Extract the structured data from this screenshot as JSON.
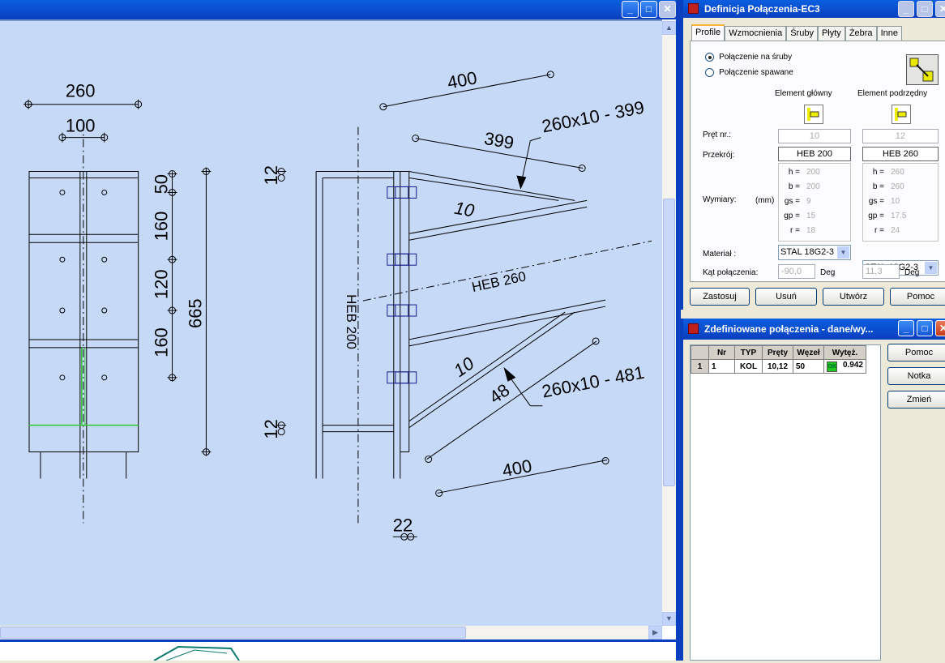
{
  "drawing": {
    "dims": {
      "d260": "260",
      "d100": "100",
      "d50": "50",
      "d160a": "160",
      "d120": "120",
      "d160b": "160",
      "d665": "665",
      "d12a": "12",
      "d12b": "12",
      "d22": "22",
      "d400top": "400",
      "d399": "399",
      "d10a": "10",
      "d10b": "10",
      "d48": "48",
      "d400bot": "400",
      "plate1": "260x10 - 399",
      "plate2": "260x10 - 481",
      "heb260": "HEB 260",
      "heb200": "HEB 200"
    }
  },
  "dialog1": {
    "title": "Definicja Połączenia-EC3",
    "tabs": [
      "Profile",
      "Wzmocnienia",
      "Śruby",
      "Płyty",
      "Żebra",
      "Inne"
    ],
    "radio1": "Połączenie na śruby",
    "radio2": "Połączenie spawane",
    "col1": "Element główny",
    "col2": "Element podrzędny",
    "pret_label": "Pręt nr.:",
    "pret1": "10",
    "pret2": "12",
    "przekroj_label": "Przekrój:",
    "przekroj1": "HEB 200",
    "przekroj2": "HEB 260",
    "wymiary_label": "Wymiary:",
    "unit": "(mm)",
    "dims1": [
      [
        "h =",
        "200"
      ],
      [
        "b =",
        "200"
      ],
      [
        "gs =",
        "9"
      ],
      [
        "gp =",
        "15"
      ],
      [
        "r =",
        "18"
      ]
    ],
    "dims2": [
      [
        "h =",
        "260"
      ],
      [
        "b =",
        "260"
      ],
      [
        "gs =",
        "10"
      ],
      [
        "gp =",
        "17.5"
      ],
      [
        "r =",
        "24"
      ]
    ],
    "material_label": "Materiał :",
    "material1": "STAL 18G2-3",
    "material2": "STAL 18G2-3",
    "kat_label": "Kąt połączenia:",
    "kat1": "-90,0",
    "kat2": "11,3",
    "deg": "Deg",
    "buttons": [
      "Zastosuj",
      "Usuń",
      "Utwórz",
      "Pomoc"
    ]
  },
  "dialog2": {
    "title": "Zdefiniowane połączenia - dane/wy...",
    "headers": [
      "Nr",
      "TYP",
      "Pręty",
      "Węzeł",
      "Wytęż."
    ],
    "row": {
      "idx": "1",
      "nr": "1",
      "typ": "KOL",
      "prety": "10,12",
      "wezel": "50",
      "status": "OK",
      "wytez": "0.942"
    },
    "buttons": [
      "Pomoc",
      "Notka",
      "Zmień"
    ]
  }
}
